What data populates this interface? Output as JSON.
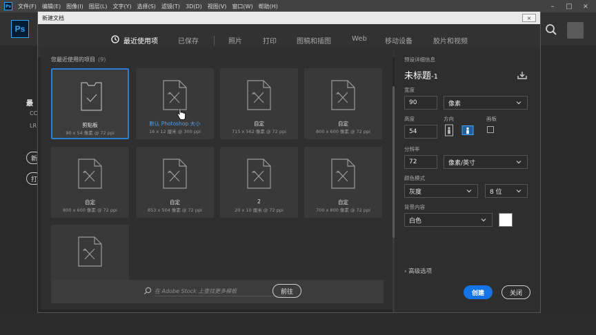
{
  "menubar": {
    "app_icon": "Ps",
    "items": [
      "文件(F)",
      "编辑(E)",
      "图像(I)",
      "图层(L)",
      "文字(Y)",
      "选择(S)",
      "滤镜(T)",
      "3D(D)",
      "视图(V)",
      "窗口(W)",
      "帮助(H)"
    ],
    "controls": [
      "–",
      "□",
      "×"
    ]
  },
  "app": {
    "logo": "Ps",
    "bg_fragments": {
      "recent": "最",
      "cc": "CC",
      "lr": "LR",
      "btn1": "新",
      "btn2": "打"
    }
  },
  "dialog": {
    "title": "新建文档",
    "close_glyph": "×",
    "tabs": [
      {
        "label": "最近使用项",
        "active": true
      },
      {
        "label": "已保存",
        "active": false
      },
      {
        "label": "照片",
        "active": false
      },
      {
        "label": "打印",
        "active": false
      },
      {
        "label": "图稿和插图",
        "active": false
      },
      {
        "label": "Web",
        "active": false
      },
      {
        "label": "移动设备",
        "active": false
      },
      {
        "label": "胶片和视频",
        "active": false
      }
    ],
    "recent_label": "您最近使用的项目",
    "recent_count": "(9)",
    "cards": [
      {
        "name": "剪贴板",
        "dims": "90 x 54 像素 @ 72 ppi",
        "icon": "clipboard-icon",
        "selected": true,
        "highlight": false
      },
      {
        "name": "默认 Photoshop 大小",
        "dims": "16 x 12 厘米 @ 300 ppi",
        "icon": "blank-doc-icon",
        "selected": false,
        "highlight": true
      },
      {
        "name": "自定",
        "dims": "715 x 562 像素 @ 72 ppi",
        "icon": "blank-doc-icon",
        "selected": false,
        "highlight": false
      },
      {
        "name": "自定",
        "dims": "800 x 600 像素 @ 72 ppi",
        "icon": "blank-doc-icon",
        "selected": false,
        "highlight": false
      },
      {
        "name": "自定",
        "dims": "800 x 600 像素 @ 72 ppi",
        "icon": "blank-doc-icon",
        "selected": false,
        "highlight": false
      },
      {
        "name": "自定",
        "dims": "853 x 504 像素 @ 72 ppi",
        "icon": "blank-doc-icon",
        "selected": false,
        "highlight": false
      },
      {
        "name": "2",
        "dims": "20 x 10 厘米 @ 72 ppi",
        "icon": "blank-doc-icon",
        "selected": false,
        "highlight": false
      },
      {
        "name": "自定",
        "dims": "700 x 800 像素 @ 72 ppi",
        "icon": "blank-doc-icon",
        "selected": false,
        "highlight": false
      },
      {
        "name": "",
        "dims": "",
        "icon": "blank-doc-icon",
        "selected": false,
        "highlight": false
      }
    ],
    "stock": {
      "placeholder": "在 Adobe Stock 上查找更多模板",
      "go_label": "前往"
    },
    "details": {
      "section_label": "预设详细信息",
      "doc_title": "未标题",
      "doc_title_suffix": "-1",
      "width_label": "宽度",
      "width_value": "90",
      "width_unit": "像素",
      "height_label": "高度",
      "height_value": "54",
      "orientation_label": "方向",
      "artboard_label": "画板",
      "resolution_label": "分辨率",
      "resolution_value": "72",
      "resolution_unit": "像素/英寸",
      "color_mode_label": "颜色模式",
      "color_mode_value": "灰度",
      "bit_depth_value": "8 位",
      "background_label": "背景内容",
      "background_value": "白色",
      "background_swatch": "#ffffff",
      "advanced_label": "高级选项",
      "create_label": "创建",
      "close_label": "关闭"
    }
  },
  "colors": {
    "accent": "#1473e6",
    "selection": "#2d7dd2",
    "highlight_text": "#4ba3f5"
  }
}
